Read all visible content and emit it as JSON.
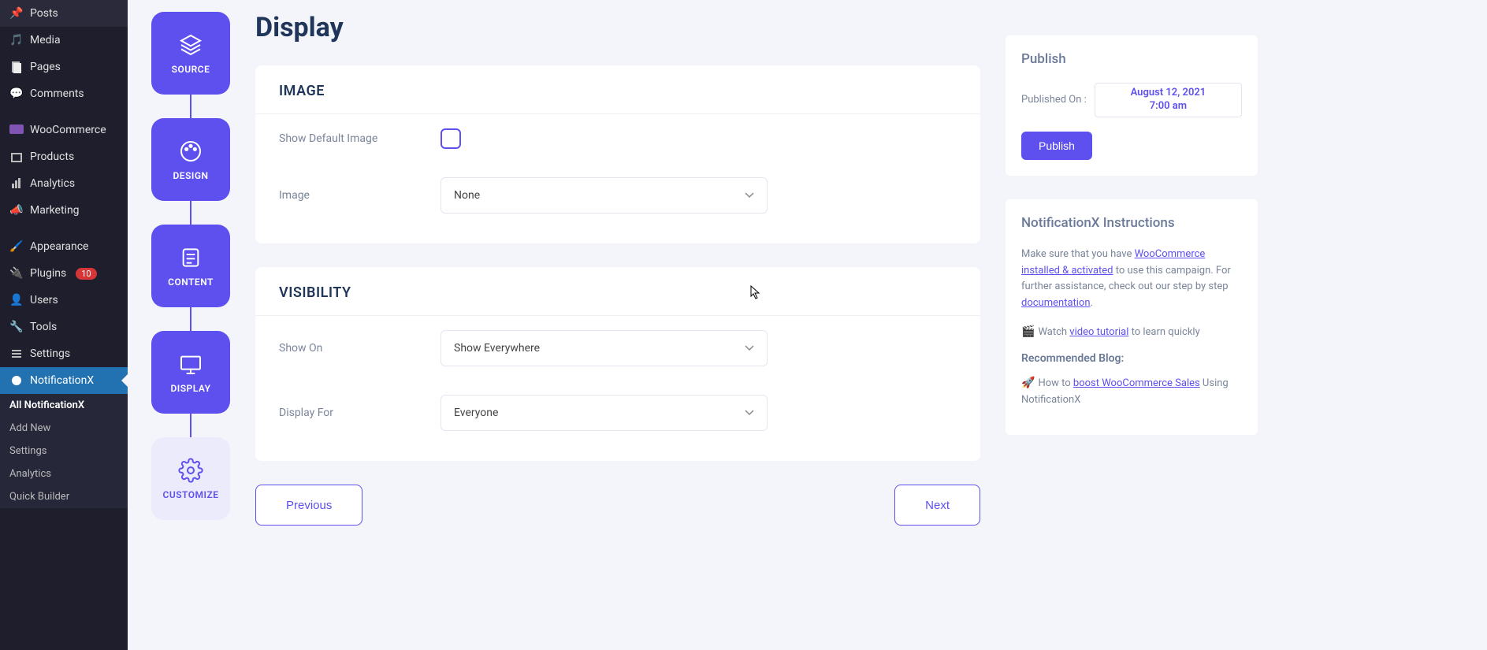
{
  "wp_menu": {
    "posts": "Posts",
    "media": "Media",
    "pages": "Pages",
    "comments": "Comments",
    "woocommerce": "WooCommerce",
    "products": "Products",
    "analytics": "Analytics",
    "marketing": "Marketing",
    "appearance": "Appearance",
    "plugins": "Plugins",
    "plugins_count": "10",
    "users": "Users",
    "tools": "Tools",
    "settings": "Settings",
    "notificationx": "NotificationX",
    "sub": {
      "all": "All NotificationX",
      "add": "Add New",
      "settings": "Settings",
      "analytics": "Analytics",
      "qb": "Quick Builder"
    }
  },
  "steps": {
    "source": "SOURCE",
    "design": "DESIGN",
    "content": "CONTENT",
    "display": "DISPLAY",
    "customize": "CUSTOMIZE"
  },
  "main": {
    "title": "Display",
    "image_section": {
      "heading": "IMAGE",
      "show_default": "Show Default Image",
      "image_label": "Image",
      "image_value": "None"
    },
    "visibility_section": {
      "heading": "VISIBILITY",
      "show_on_label": "Show On",
      "show_on_value": "Show Everywhere",
      "display_for_label": "Display For",
      "display_for_value": "Everyone"
    },
    "prev": "Previous",
    "next": "Next"
  },
  "publish_panel": {
    "heading": "Publish",
    "on_label": "Published On :",
    "date_line1": "August 12, 2021",
    "date_line2": "7:00 am",
    "button": "Publish"
  },
  "instructions_panel": {
    "heading": "NotificationX Instructions",
    "p1_prefix": "Make sure that you have ",
    "p1_link": "WooCommerce installed & activated",
    "p1_suffix": " to use this campaign. For further assistance, check out our step by step ",
    "p1_doclink": "documentation",
    "p2_prefix": "Watch ",
    "p2_link": "video tutorial",
    "p2_suffix": " to learn quickly",
    "blog_heading": "Recommended Blog:",
    "p3_prefix": "How to ",
    "p3_link": "boost WooCommerce Sales",
    "p3_suffix": " Using NotificationX"
  }
}
